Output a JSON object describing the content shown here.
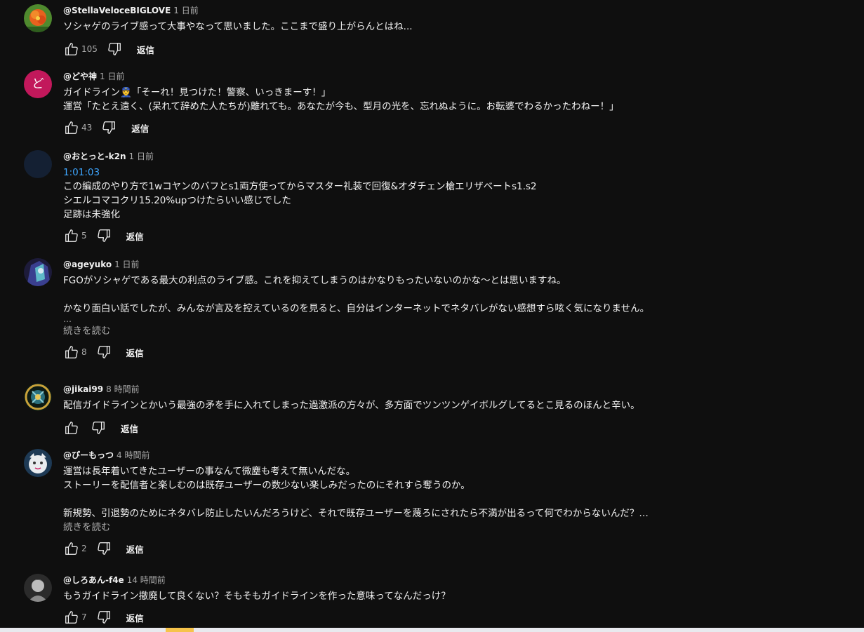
{
  "reply_label": "返信",
  "read_more_label": "続きを読む",
  "comments": [
    {
      "handle": "@StellaVeloceBIGLOVE",
      "time": "1 日前",
      "lines": [
        "ソシャゲのライブ感って大事やなって思いました。ここまで盛り上がらんとはね..."
      ],
      "likes": "105"
    },
    {
      "handle": "@どや神",
      "avatar_letter": "ど",
      "time": "1 日前",
      "lines": [
        "ガイドライン👮「そーれ！見つけた！警察、いっきまーす！」",
        "運営「たとえ遠く、(呆れて辞めた人たちが)離れても。あなたが今も、型月の光を、忘れぬように。お転婆でわるかったわねー！」"
      ],
      "likes": "43"
    },
    {
      "handle": "@おとっと-k2n",
      "time": "1 日前",
      "timestamp": "1:01:03",
      "lines": [
        "この編成のやり方で1wコヤンのバフとs1両方使ってからマスター礼装で回復&オダチェン槍エリザベートs1.s2",
        "シエルコマコクリ15.20%upつけたらいい感じでした",
        "足跡は未強化"
      ],
      "likes": "5"
    },
    {
      "handle": "@ageyuko",
      "time": "1 日前",
      "lines": [
        "FGOがソシャゲである最大の利点のライブ感。これを抑えてしまうのはかなりもったいないのかな〜とは思いますね。",
        "",
        "かなり面白い話でしたが、みんなが言及を控えているのを見ると、自分はインターネットでネタバレがない感想すら呟く気になりません。"
      ],
      "ellipsis": "…",
      "likes": "8"
    },
    {
      "handle": "@jikai99",
      "time": "8 時間前",
      "lines": [
        "配信ガイドラインとかいう最強の矛を手に入れてしまった過激派の方々が、多方面でツンツンゲイボルグしてるとこ見るのほんと辛い。"
      ],
      "likes": ""
    },
    {
      "handle": "@ぴーもっつ",
      "time": "4 時間前",
      "lines": [
        "運営は長年着いてきたユーザーの事なんて微塵も考えて無いんだな。",
        "ストーリーを配信者と楽しむのは既存ユーザーの数少ない楽しみだったのにそれすら奪うのか。",
        "",
        "新規勢、引退勢のためにネタバレ防止したいんだろうけど、それで既存ユーザーを蔑ろにされたら不満が出るって何でわからないんだ？…"
      ],
      "likes": "2"
    },
    {
      "handle": "@しろあん-f4e",
      "time": "14 時間前",
      "lines": [
        "もうガイドライン撤廃して良くない？そもそもガイドラインを作った意味ってなんだっけ？"
      ],
      "likes": "7"
    }
  ]
}
